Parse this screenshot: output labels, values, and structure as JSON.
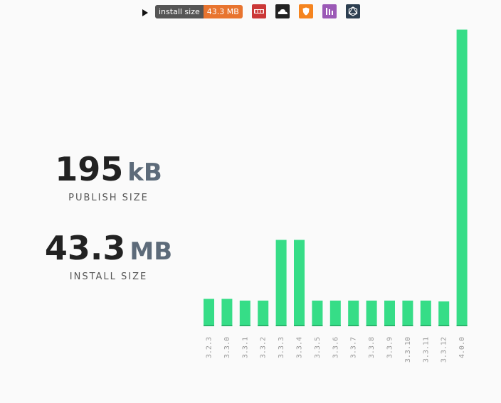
{
  "toolbar": {
    "badge_label": "install size",
    "badge_value": "43.3 MB",
    "icons": [
      {
        "name": "npm-icon",
        "color": "#cb3837"
      },
      {
        "name": "cloud-icon",
        "color": "#222222"
      },
      {
        "name": "shield-icon",
        "color": "#f5841f"
      },
      {
        "name": "bundle-chart-icon",
        "color": "#9b59b6"
      },
      {
        "name": "graph-icon",
        "color": "#2c3e50"
      }
    ]
  },
  "stats": {
    "publish": {
      "value": "195",
      "unit": "kB",
      "label": "PUBLISH SIZE"
    },
    "install": {
      "value": "43.3",
      "unit": "MB",
      "label": "INSTALL SIZE"
    }
  },
  "colors": {
    "bar": "#36dd87",
    "bar_base": "#2ab56c"
  },
  "chart_data": {
    "type": "bar",
    "categories": [
      "3.2.3",
      "3.3.0",
      "3.3.1",
      "3.3.2",
      "3.3.3",
      "3.3.4",
      "3.3.5",
      "3.3.6",
      "3.3.7",
      "3.3.8",
      "3.3.9",
      "3.3.10",
      "3.3.11",
      "3.3.12",
      "4.0.0"
    ],
    "values": [
      3.2,
      3.2,
      3.0,
      3.0,
      10.1,
      10.1,
      3.0,
      3.0,
      3.0,
      3.0,
      3.0,
      3.0,
      3.0,
      2.9,
      34.7
    ],
    "ylim": [
      0,
      35
    ],
    "grid": false
  }
}
